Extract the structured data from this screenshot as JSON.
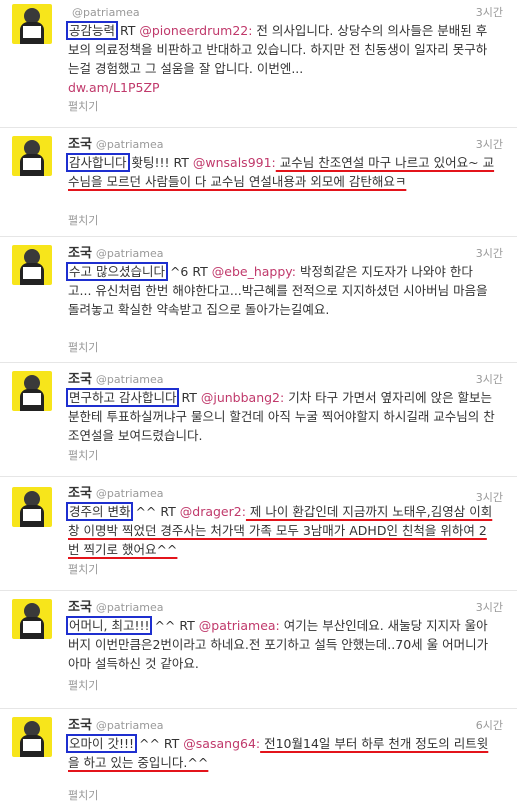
{
  "tweets": [
    {
      "time": "3시간",
      "handle": "@patriamea",
      "keyword": "공감능력",
      "rt": " RT ",
      "mention": "@pioneerdrum22:",
      "text1": " 전 의사입니다. 상당수의 의사들은 분배된 후보의 의료정책을 비판하고 반대하고 있습니다. 하지만 전 친동생이 일자리 못구하는걸 경험했고 그 설움을 잘 압니다. 이번엔...",
      "link": "dw.am/L1P5ZP",
      "expand": "펼치기"
    },
    {
      "name": "조국",
      "time": "3시간",
      "handle": "@patriamea",
      "keyword": "감사합니다",
      "rt": " 홧팅!!! RT ",
      "mention": "@wnsals991:",
      "text1": " 교수님 찬조연설 마구 나르고 있어요~ 교수님을 모르던 사람들이 다 교수님 연설내용과 외모에 감탄해요ㅋ",
      "expand": "펼치기"
    },
    {
      "name": "조국",
      "time": "3시간",
      "handle": "@patriamea",
      "keyword": "수고 많으셨습니다",
      "rt": " ^6 RT ",
      "mention": "@ebe_happy:",
      "text1": " 박정희같은 지도자가 나와야 한다고... 유신처럼 한번 해야한다고...박근혜를 전적으로 지지하셨던 시아버님 마음을 돌려놓고 확실한 약속받고 집으로 돌아가는길예요.",
      "expand": "펼치기"
    },
    {
      "name": "조국",
      "time": "3시간",
      "handle": "@patriamea",
      "keyword": "면구하고 감사합니다",
      "rt": " RT ",
      "mention": "@junbbang2:",
      "text1": " 기차 타구 가면서 옆자리에 앉은 할보는 분한테 투표하실꺼냐구 물으니 할건데 아직 누굴 찍어야할지 하시길래 교수님의 찬조연설을 보여드렸습니다.",
      "expand": "펼치기"
    },
    {
      "name": "조국",
      "time": "3시간",
      "handle": "@patriamea",
      "keyword": "경주의 변화",
      "rt": " ^^ RT ",
      "mention": "@drager2:",
      "text1": " 제 나이 환갑인데 지금까지 노태우,김영삼 이회창 이명박 찍었던 경주사는 처가댁 가족 모두 3남매가 ADHD인 친척을 위하여 2번 찍기로 했어요^^",
      "expand": "펼치기"
    },
    {
      "name": "조국",
      "time": "3시간",
      "handle": "@patriamea",
      "keyword": "어머니, 최고!!!",
      "rt": " ^^ RT ",
      "mention": "@patriamea:",
      "text1": " 여기는 부산인데요. 새눌당 지지자 울아버지 이번만큼은2번이라고 하네요.전 포기하고 설득 안했는데..70세 울 어머니가 아마 설득하신 것 같아요.",
      "expand": "펼치기"
    },
    {
      "name": "조국",
      "time": "6시간",
      "handle": "@patriamea",
      "keyword": "오마이 갓!!!",
      "rt": " ^^ RT ",
      "mention": "@sasang64:",
      "text1": " 전10월14일 부터 하루 천개 정도의 리트윗을 하고 있는 중입니다.^^",
      "expand": "펼치기"
    }
  ]
}
